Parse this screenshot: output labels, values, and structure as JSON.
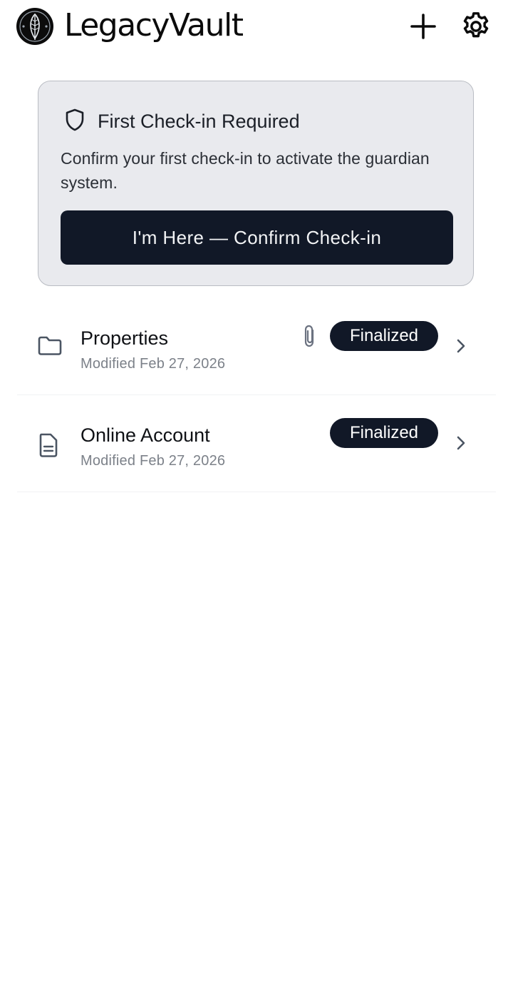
{
  "header": {
    "app_title": "LegacyVault",
    "add_icon": "plus-icon",
    "settings_icon": "gear-icon",
    "logo_icon": "feather-logo"
  },
  "checkin_card": {
    "title": "First Check-in Required",
    "message": "Confirm your first check-in to activate the guardian system.",
    "button_label": "I'm Here — Confirm Check-in",
    "icon": "shield-icon"
  },
  "items": [
    {
      "title": "Properties",
      "subtitle": "Modified Feb 27, 2026",
      "status": "Finalized",
      "icon": "folder-icon",
      "has_attachment": true
    },
    {
      "title": "Online Account",
      "subtitle": "Modified Feb 27, 2026",
      "status": "Finalized",
      "icon": "document-icon",
      "has_attachment": false
    }
  ],
  "colors": {
    "primary_dark": "#111827",
    "card_bg": "#e9eaee",
    "muted_text": "#7c8189"
  }
}
